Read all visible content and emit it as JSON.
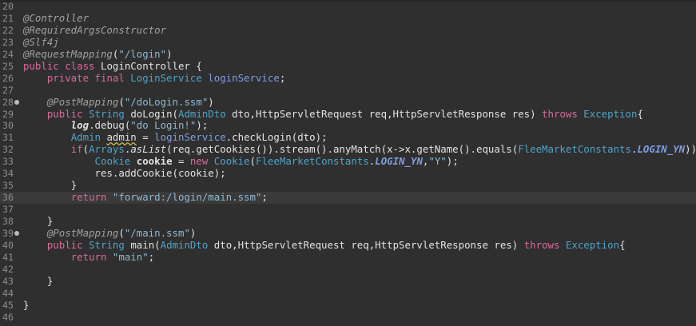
{
  "editor": {
    "language": "java",
    "colors": {
      "background": "#2f2f2f",
      "keyword": "#d96a9d",
      "type": "#4fa3c8",
      "string": "#8fb8d4",
      "annotation": "#a0a0a0",
      "line_number": "#8c8c8c"
    },
    "line_numbers": [
      "20",
      "21",
      "22",
      "23",
      "24",
      "25",
      "26",
      "27",
      "28",
      "29",
      "30",
      "31",
      "32",
      "33",
      "34",
      "35",
      "36",
      "37",
      "38",
      "39",
      "40",
      "41",
      "42",
      "43",
      "44",
      "45",
      "46"
    ],
    "current_line": "36",
    "fold_markers": [
      "28",
      "39"
    ],
    "code": {
      "l21": "@Controller",
      "l22": "@RequiredArgsConstructor",
      "l23": "@Slf4j",
      "l24_ann": "@RequestMapping",
      "l24_str": "\"/login\"",
      "l25_kw": "public class",
      "l25_rest": " LoginController {",
      "l26_kw": "private final",
      "l26_type": "LoginService",
      "l26_fld": "loginService",
      "l28_ann": "@PostMapping",
      "l28_str": "\"/doLogin.ssm\"",
      "l29_kw": "public",
      "l29_type1": "String",
      "l29_name": "doLogin",
      "l29_type2": "AdminDto",
      "l29_params": " dto,HttpServletRequest req,HttpServletResponse res) ",
      "l29_throws": "throws",
      "l29_exc": "Exception",
      "l30_log": "log",
      "l30_rest": ".debug(",
      "l30_str": "\"do Login!\"",
      "l31_type": "Admin",
      "l31_var": "admin",
      "l31_eq": " = ",
      "l31_fld": "loginService",
      "l31_rest": ".checkLogin(dto);",
      "l32_kw": "if",
      "l32_type": "Arrays",
      "l32_m": "asList",
      "l32_mid": "(req.getCookies()).stream().anyMatch(x->x.getName().equals(",
      "l32_type2": "FleeMarketConstants",
      "l32_sf": "LOGIN_YN",
      "l32_end": "))) {",
      "l33_type": "Cookie",
      "l33_var": "cookie",
      "l33_kw": "new",
      "l33_type2": "Cookie",
      "l33_type3": "FleeMarketConstants",
      "l33_sf": "LOGIN_YN",
      "l33_str": "\"Y\"",
      "l34": "res.addCookie(cookie);",
      "l35": "}",
      "l36_kw": "return",
      "l36_str": "\"forward:/login/main.ssm\"",
      "l38": "}",
      "l39_ann": "@PostMapping",
      "l39_str": "\"/main.ssm\"",
      "l40_kw": "public",
      "l40_type1": "String",
      "l40_name": "main",
      "l40_type2": "AdminDto",
      "l40_params": " dto,HttpServletRequest req,HttpServletResponse res) ",
      "l40_throws": "throws",
      "l40_exc": "Exception",
      "l41_kw": "return",
      "l41_str": "\"main\"",
      "l43": "}",
      "l45": "}"
    }
  }
}
